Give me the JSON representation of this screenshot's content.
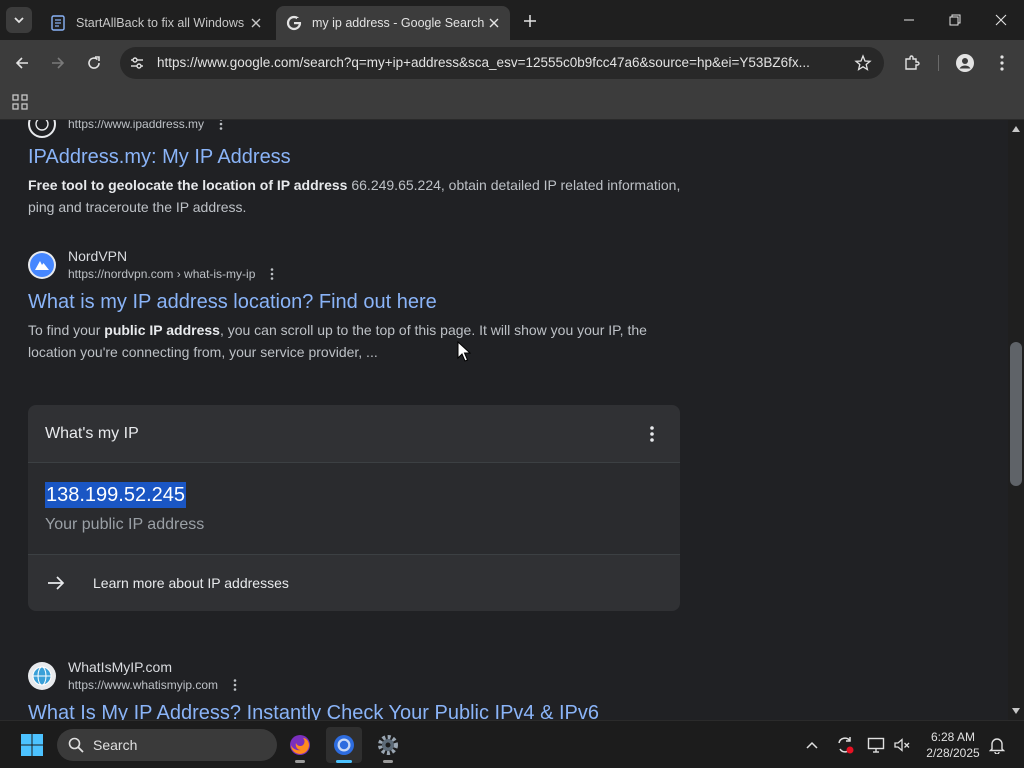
{
  "browser": {
    "tabs": [
      {
        "title": "StartAllBack to fix all Windows",
        "active": false
      },
      {
        "title": "my ip address - Google Search",
        "active": true
      }
    ],
    "url": "https://www.google.com/search?q=my+ip+address&sca_esv=12555c0b9fcc47a6&source=hp&ei=Y53BZ6fx..."
  },
  "results": [
    {
      "site_name": "",
      "url": "https://www.ipaddress.my",
      "title": "IPAddress.my: My IP Address",
      "snippet_bold": "Free tool to geolocate the location of IP address",
      "snippet_rest": " 66.249.65.224, obtain detailed IP related information, ping and traceroute the IP address."
    },
    {
      "site_name": "NordVPN",
      "url": "https://nordvpn.com › what-is-my-ip",
      "title": "What is my IP address location? Find out here",
      "snippet_pre": "To find your ",
      "snippet_bold": "public IP address",
      "snippet_rest": ", you can scroll up to the top of this page. It will show you your IP, the location you're connecting from, your service provider, ..."
    },
    {
      "site_name": "WhatIsMyIP.com",
      "url": "https://www.whatismyip.com",
      "title": "What Is My IP Address? Instantly Check Your Public IPv4 & IPv6"
    }
  ],
  "ip_card": {
    "heading": "What's my IP",
    "ip": "138.199.52.245",
    "caption": "Your public IP address",
    "learn_more": "Learn more about IP addresses"
  },
  "taskbar": {
    "search_label": "Search",
    "time": "6:28 AM",
    "date": "2/28/2025"
  },
  "colors": {
    "link": "#8ab4f8",
    "selection": "#1a56c4",
    "active_indicator": "#4cc2ff"
  }
}
